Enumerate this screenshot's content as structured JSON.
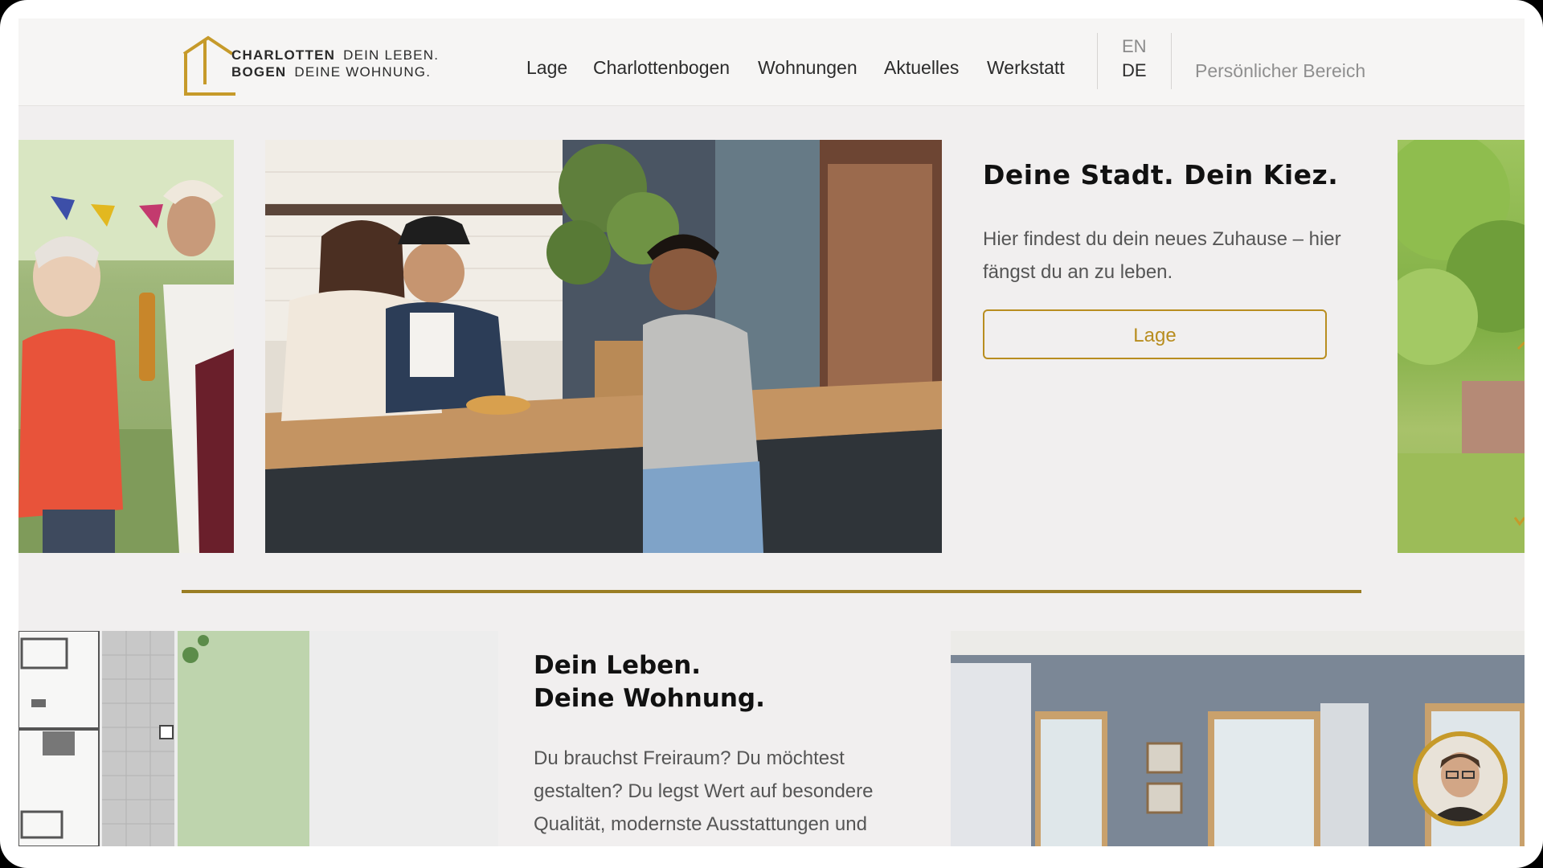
{
  "brand": {
    "name_line1": "CHARLOTTEN",
    "name_line2": "BOGEN",
    "tagline_line1": "DEIN LEBEN.",
    "tagline_line2": "DEINE WOHNUNG."
  },
  "nav": {
    "items": [
      {
        "label": "Lage"
      },
      {
        "label": "Charlottenbogen"
      },
      {
        "label": "Wohnungen"
      },
      {
        "label": "Aktuelles"
      },
      {
        "label": "Werkstatt"
      }
    ],
    "languages": {
      "en": "EN",
      "de": "DE"
    },
    "personal_area": "Persönlicher Bereich"
  },
  "hero_slide": {
    "title": "Deine Stadt. Dein Kiez.",
    "body": "Hier findest du dein neues Zuhause – hier fängst du an zu leben.",
    "button_label": "Lage"
  },
  "section2": {
    "title_line1": "Dein Leben.",
    "title_line2": "Deine Wohnung.",
    "body": "Du brauchst Freiraum? Du möchtest gestalten? Du legst Wert auf besondere Qualität, modernste Ausstattungen und"
  },
  "colors": {
    "accent": "#b88d1f",
    "divider": "#9a7d23",
    "background": "#f1efef"
  }
}
